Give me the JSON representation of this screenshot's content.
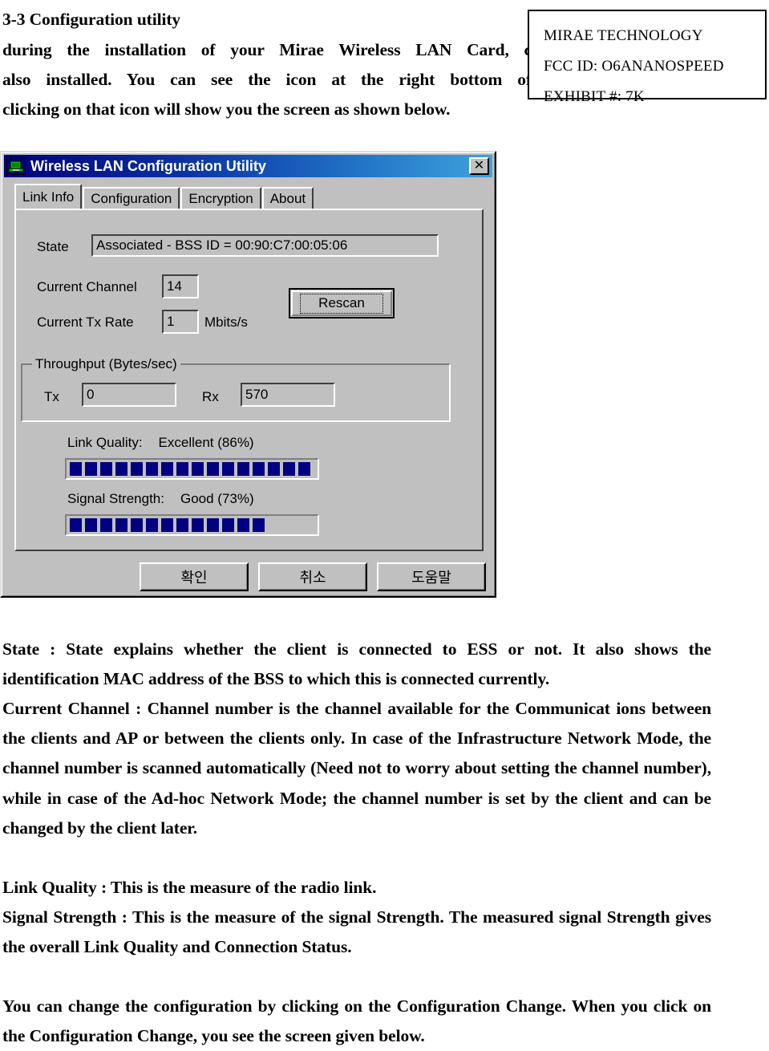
{
  "document": {
    "heading": "3-3 Configuration utility",
    "intro_lines": [
      "during the installation of your Mirae Wireless LAN Card, c",
      "also installed. You can see the icon at the right bottom of",
      "clicking on that icon will show you the screen as shown below."
    ],
    "paragraphs": {
      "state": "State : State explains whether the client is connected to ESS or not. It also shows the identification MAC address of the BSS to which this is connected currently.",
      "current_channel": "Current Channel : Channel number is the channel available for the Communicat ions between the clients and AP or between the clients only. In case of the Infrastructure Network Mode, the channel number is scanned automatically (Need not to worry about setting the channel number), while in case of the Ad-hoc Network Mode; the channel number is set by the client and can be changed by the client later.",
      "link_quality": "Link Quality : This is the measure of the radio link.",
      "signal_strength": "Signal Strength : This is the measure of the signal Strength. The measured signal Strength gives the overall Link Quality and Connection Status.",
      "configuration_change": "You can change the configuration by clicking on the Configuration Change. When you click on the Configuration Change, you see the screen given below."
    }
  },
  "fcc_box": {
    "company": "MIRAE TECHNOLOGY",
    "fcc_id": "FCC ID:  O6ANANOSPEED",
    "exhibit": "EXHIBIT #: 7K"
  },
  "dialog": {
    "title": "Wireless LAN Configuration Utility",
    "titlebar_icon": "wireless-card-icon",
    "close_label": "✕",
    "tabs": [
      {
        "label": "Link Info",
        "active": true
      },
      {
        "label": "Configuration",
        "active": false
      },
      {
        "label": "Encryption",
        "active": false
      },
      {
        "label": "About",
        "active": false
      }
    ],
    "link_info": {
      "state_label": "State",
      "state_value": "Associated - BSS ID = 00:90:C7:00:05:06",
      "channel_label": "Current Channel",
      "channel_value": "14",
      "tx_rate_label": "Current Tx Rate",
      "tx_rate_value": "1",
      "tx_rate_units": "Mbits/s",
      "rescan_label": "Rescan",
      "throughput_legend": "Throughput (Bytes/sec)",
      "tx_label": "Tx",
      "tx_value": "0",
      "rx_label": "Rx",
      "rx_value": "570",
      "link_quality_label": "Link Quality:",
      "link_quality_value": "Excellent (86%)",
      "link_quality_percent": 86,
      "link_quality_blocks": 16,
      "signal_strength_label": "Signal Strength:",
      "signal_strength_value": "Good (73%)",
      "signal_strength_percent": 73,
      "signal_strength_blocks": 13,
      "meter_total_blocks": 18,
      "meter_block_color": "#000080"
    },
    "buttons": {
      "ok": "확인",
      "cancel": "취소",
      "help": "도움말"
    }
  }
}
